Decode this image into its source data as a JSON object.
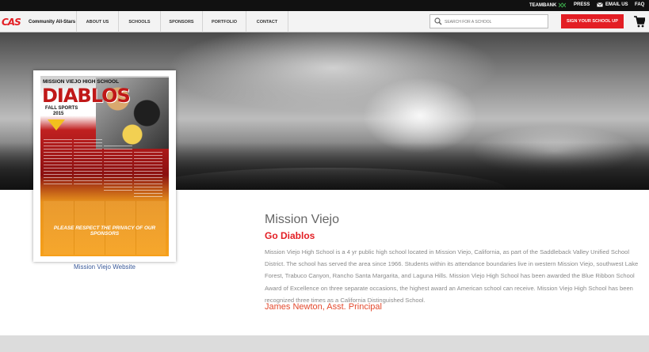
{
  "topbar": {
    "links": [
      {
        "label": "TEAMBANK",
        "icon": "teambank-icon"
      },
      {
        "label": "PRESS"
      },
      {
        "label": "EMAIL US",
        "icon": "email-icon"
      },
      {
        "label": "FAQ"
      }
    ]
  },
  "header": {
    "logo_text": "CAS",
    "subtitle": "Community All-Stars",
    "nav": [
      "ABOUT US",
      "SCHOOLS",
      "SPONSORS",
      "PORTFOLIO",
      "CONTACT"
    ],
    "search_placeholder": "SEARCH FOR A SCHOOL",
    "signup_label": "SIGN YOUR SCHOOL UP",
    "cart_icon": "cart-icon"
  },
  "poster": {
    "school": "MISSION VIEJO HIGH SCHOOL",
    "mascot": "DIABLOS",
    "season": "FALL SPORTS",
    "year": "2015",
    "footer": "PLEASE RESPECT THE PRIVACY OF OUR SPONSORS"
  },
  "profile": {
    "website_link": "Mission Viejo Website",
    "name": "Mission Viejo",
    "tagline": "Go Diablos",
    "description": "Mission Viejo High School is a 4 yr public high school located in Mission Viejo, California, as part of the Saddleback Valley Unified School District. The school has served the area since 1966. Students within its attendance boundaries live in western Mission Viejo, southwest Lake Forest, Trabuco Canyon, Rancho Santa Margarita, and Laguna Hills. Mission Viejo High School has been awarded the Blue Ribbon School Award of Excellence on three separate occasions, the highest award an American school can receive. Mission Viejo High School has been recognized three times as a California Distinguished School.",
    "contact": "James Newton, Asst. Principal"
  },
  "colors": {
    "accent": "#e31e24",
    "topbar": "#111111",
    "link": "#3a5a9a"
  }
}
